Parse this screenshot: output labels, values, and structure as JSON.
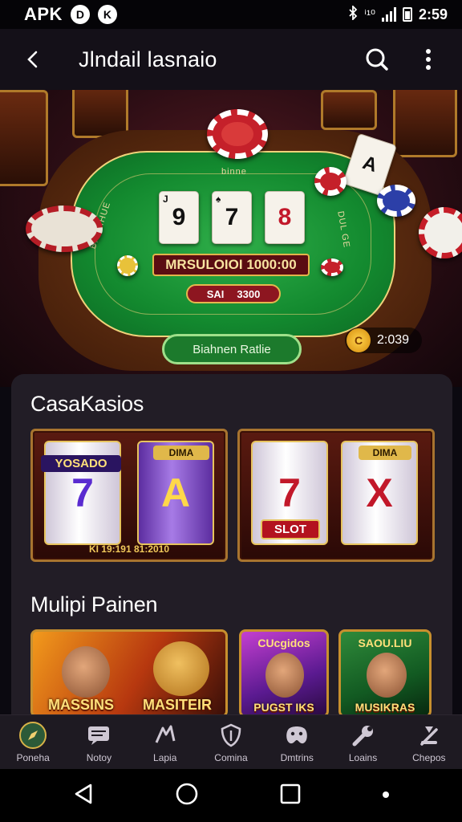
{
  "status_bar": {
    "apk_label": "APK",
    "left_icon_1": "D",
    "left_icon_2": "K",
    "time": "2:59",
    "signal_text": "ⁱ¹⁰"
  },
  "app_bar": {
    "title": "Jlndail lasnaio"
  },
  "hero": {
    "table_sign_top": "binne",
    "cards": [
      {
        "pip": "J",
        "value": "9"
      },
      {
        "pip": "♠",
        "value": "7"
      },
      {
        "pip": "",
        "value": "8"
      }
    ],
    "felt_left_text": "BICGIHUE",
    "felt_right_text": "DUL GE",
    "plate_text": "MRSULOIOI 1000:00",
    "red_pill_left": "SAI",
    "red_pill_right": "3300",
    "play_button": "Biahnen Ratlie",
    "coins": "2:039",
    "coin_symbol": "C"
  },
  "sections": {
    "casino_title": "CasaKasios",
    "slot_1": {
      "banner_left": "YOSADO",
      "reel_left": "7",
      "banner_right": "DIMA",
      "reel_right": "A",
      "footer": "KI 19:191 81:2010"
    },
    "slot_2": {
      "banner_left": "",
      "reel_left": "7",
      "banner_right": "DIMA",
      "reel_right": "X",
      "slot_tag": "SLOT"
    },
    "multi_title": "Mulipi Painen",
    "promos": [
      {
        "label": "MASSINS"
      },
      {
        "label": "MASITEIR"
      },
      {
        "label": "PUGST IKS",
        "top": "CUcgidos"
      },
      {
        "label": "MUSIKRAS",
        "top": "SAOU.LIU"
      }
    ]
  },
  "bottom_nav": [
    {
      "label": "Poneha",
      "icon": "compass-icon",
      "active": true
    },
    {
      "label": "Notoy",
      "icon": "chat-icon",
      "active": false
    },
    {
      "label": "Lapia",
      "icon": "dice-icon",
      "active": false
    },
    {
      "label": "Comina",
      "icon": "shield-icon",
      "active": false
    },
    {
      "label": "Dmtrins",
      "icon": "gamepad-icon",
      "active": false
    },
    {
      "label": "Loains",
      "icon": "wrench-icon",
      "active": false
    },
    {
      "label": "Chepos",
      "icon": "tools-icon",
      "active": false
    }
  ],
  "colors": {
    "felt": "#1a8f32",
    "gold": "#e2b44a",
    "panel": "#221d26",
    "active_nav": "#d7b248"
  }
}
